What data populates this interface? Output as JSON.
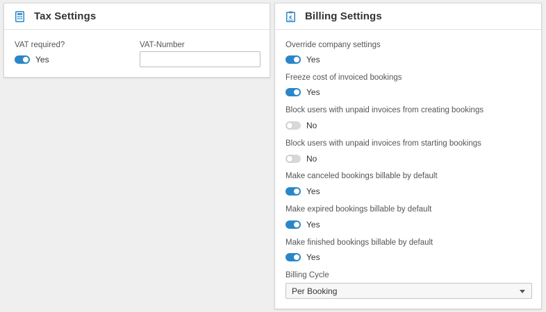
{
  "tax": {
    "title": "Tax Settings",
    "icon": "calculator-icon",
    "vat_required": {
      "label": "VAT required?",
      "on": true,
      "value_text": "Yes"
    },
    "vat_number": {
      "label": "VAT-Number",
      "value": "",
      "placeholder": ""
    }
  },
  "billing": {
    "title": "Billing Settings",
    "icon": "invoice-clipboard-icon",
    "settings": [
      {
        "label": "Override company settings",
        "on": true,
        "value_text": "Yes"
      },
      {
        "label": "Freeze cost of invoiced bookings",
        "on": true,
        "value_text": "Yes"
      },
      {
        "label": "Block users with unpaid invoices from creating bookings",
        "on": false,
        "value_text": "No"
      },
      {
        "label": "Block users with unpaid invoices from starting bookings",
        "on": false,
        "value_text": "No"
      },
      {
        "label": "Make canceled bookings billable by default",
        "on": true,
        "value_text": "Yes"
      },
      {
        "label": "Make expired bookings billable by default",
        "on": true,
        "value_text": "Yes"
      },
      {
        "label": "Make finished bookings billable by default",
        "on": true,
        "value_text": "Yes"
      }
    ],
    "billing_cycle": {
      "label": "Billing Cycle",
      "selected": "Per Booking"
    }
  },
  "colors": {
    "accent": "#2a86c9",
    "toggle_off": "#d8d8d8",
    "background": "#efefef"
  }
}
